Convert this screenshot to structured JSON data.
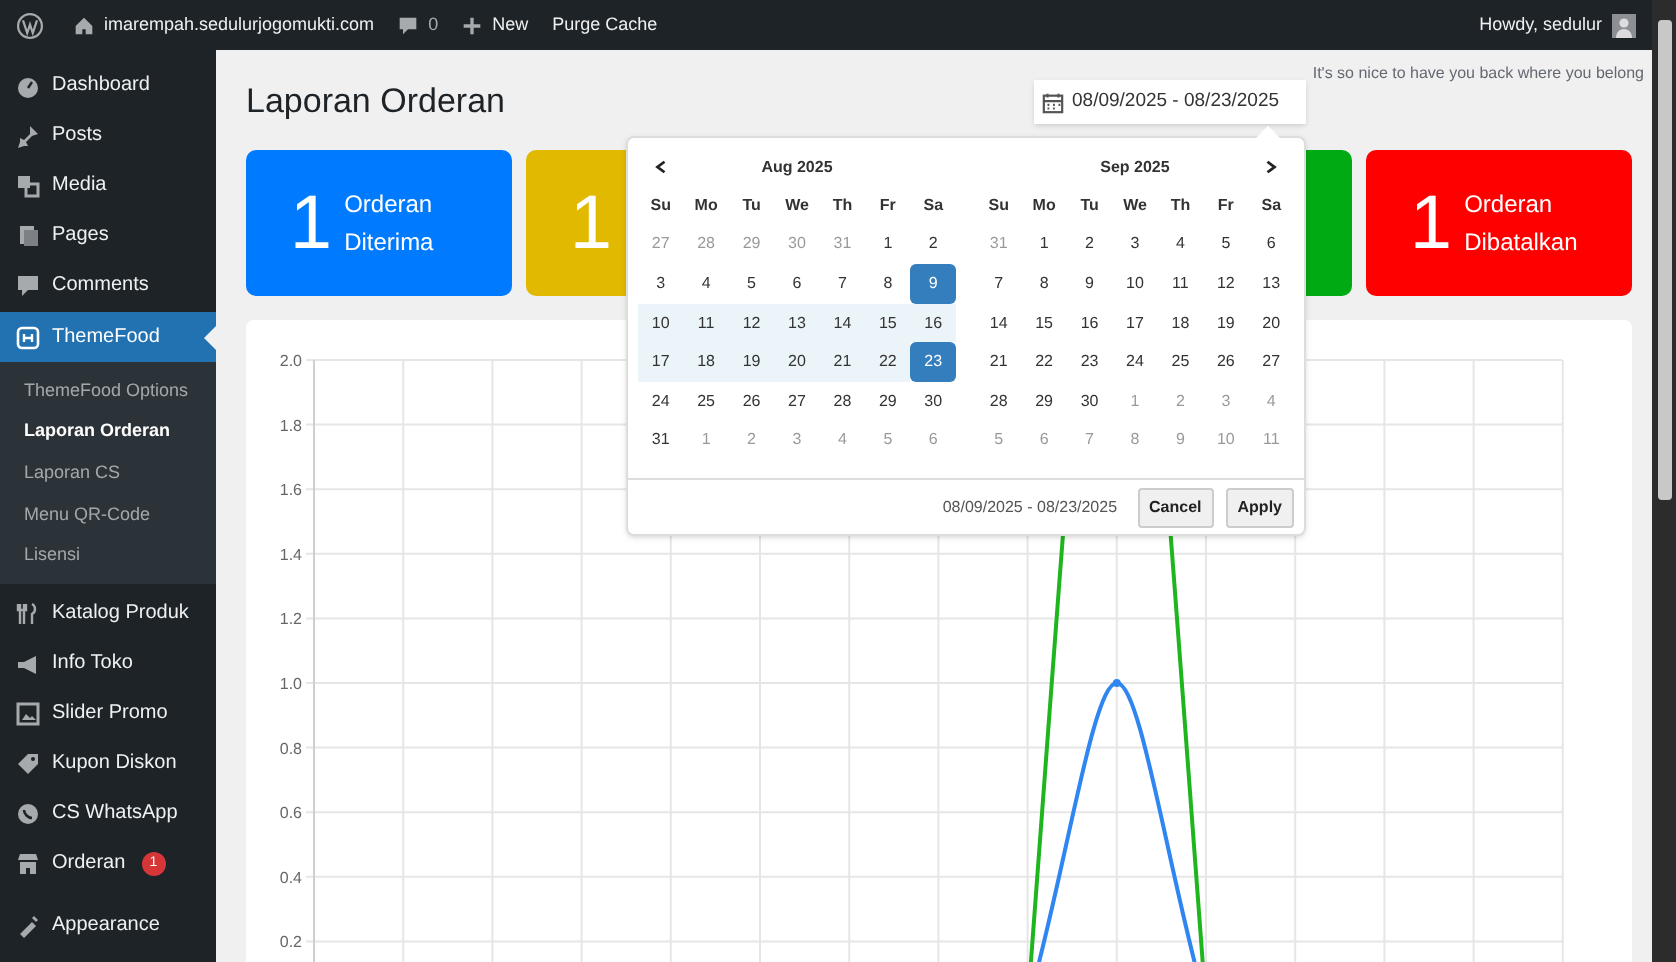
{
  "admin_bar": {
    "site": "imarempah.sedulurjogomukti.com",
    "comments": "0",
    "new": "New",
    "purge_cache": "Purge Cache",
    "greeting": "Howdy, sedulur"
  },
  "sidebar": {
    "items": [
      {
        "label": "Dashboard",
        "selected": false
      },
      {
        "label": "Posts",
        "selected": false
      },
      {
        "label": "Media",
        "selected": false
      },
      {
        "label": "Pages",
        "selected": false
      },
      {
        "label": "Comments",
        "selected": false
      },
      {
        "label": "ThemeFood",
        "selected": true,
        "children": [
          {
            "label": "ThemeFood Options",
            "selected": false
          },
          {
            "label": "Laporan Orderan",
            "selected": true
          },
          {
            "label": "Laporan CS",
            "selected": false
          },
          {
            "label": "Menu QR-Code",
            "selected": false
          },
          {
            "label": "Lisensi",
            "selected": false
          }
        ]
      },
      {
        "label": "Katalog Produk",
        "selected": false
      },
      {
        "label": "Info Toko",
        "selected": false
      },
      {
        "label": "Slider Promo",
        "selected": false
      },
      {
        "label": "Kupon Diskon",
        "selected": false
      },
      {
        "label": "CS WhatsApp",
        "selected": false
      },
      {
        "label": "Orderan",
        "selected": false,
        "badge": "1"
      },
      {
        "label": "Appearance",
        "selected": false
      }
    ]
  },
  "page": {
    "title": "Laporan Orderan",
    "welcome": "It's so nice to have you back where you belong",
    "date_range": "08/09/2025 - 08/23/2025"
  },
  "cards": [
    {
      "color": "#007bff",
      "number": "1",
      "label": "Orderan Diterima"
    },
    {
      "color": "#e0b900",
      "number": "1"
    },
    {
      "color": "#00aa13"
    },
    {
      "color": "#ff0000",
      "number": "1",
      "label": "Orderan Dibatalkan"
    }
  ],
  "chart": {
    "y_labels": [
      "2.0",
      "1.8",
      "1.6",
      "1.4",
      "1.2",
      "1.0",
      "0.8",
      "0.6",
      "0.4",
      "0.2"
    ]
  },
  "date_picker": {
    "months": [
      {
        "title": "Aug 2025",
        "weekdays": [
          "Su",
          "Mo",
          "Tu",
          "We",
          "Th",
          "Fr",
          "Sa"
        ],
        "weeks": [
          [
            {
              "text": "27",
              "off": true,
              "in_range": false,
              "selected": false
            },
            {
              "text": "28",
              "off": true,
              "in_range": false,
              "selected": false
            },
            {
              "text": "29",
              "off": true,
              "in_range": false,
              "selected": false
            },
            {
              "text": "30",
              "off": true,
              "in_range": false,
              "selected": false
            },
            {
              "text": "31",
              "off": true,
              "in_range": false,
              "selected": false
            },
            {
              "text": "1",
              "off": false,
              "in_range": false,
              "selected": false
            },
            {
              "text": "2",
              "off": false,
              "in_range": false,
              "selected": false
            }
          ],
          [
            {
              "text": "3",
              "off": false,
              "in_range": false,
              "selected": false
            },
            {
              "text": "4",
              "off": false,
              "in_range": false,
              "selected": false
            },
            {
              "text": "5",
              "off": false,
              "in_range": false,
              "selected": false
            },
            {
              "text": "6",
              "off": false,
              "in_range": false,
              "selected": false
            },
            {
              "text": "7",
              "off": false,
              "in_range": false,
              "selected": false
            },
            {
              "text": "8",
              "off": false,
              "in_range": false,
              "selected": false
            },
            {
              "text": "9",
              "off": false,
              "in_range": true,
              "selected": true
            }
          ],
          [
            {
              "text": "10",
              "off": false,
              "in_range": true,
              "selected": false
            },
            {
              "text": "11",
              "off": false,
              "in_range": true,
              "selected": false
            },
            {
              "text": "12",
              "off": false,
              "in_range": true,
              "selected": false
            },
            {
              "text": "13",
              "off": false,
              "in_range": true,
              "selected": false
            },
            {
              "text": "14",
              "off": false,
              "in_range": true,
              "selected": false
            },
            {
              "text": "15",
              "off": false,
              "in_range": true,
              "selected": false
            },
            {
              "text": "16",
              "off": false,
              "in_range": true,
              "selected": false
            }
          ],
          [
            {
              "text": "17",
              "off": false,
              "in_range": true,
              "selected": false
            },
            {
              "text": "18",
              "off": false,
              "in_range": true,
              "selected": false
            },
            {
              "text": "19",
              "off": false,
              "in_range": true,
              "selected": false
            },
            {
              "text": "20",
              "off": false,
              "in_range": true,
              "selected": false
            },
            {
              "text": "21",
              "off": false,
              "in_range": true,
              "selected": false
            },
            {
              "text": "22",
              "off": false,
              "in_range": true,
              "selected": false
            },
            {
              "text": "23",
              "off": false,
              "in_range": true,
              "selected": true
            }
          ],
          [
            {
              "text": "24",
              "off": false,
              "in_range": false,
              "selected": false
            },
            {
              "text": "25",
              "off": false,
              "in_range": false,
              "selected": false
            },
            {
              "text": "26",
              "off": false,
              "in_range": false,
              "selected": false
            },
            {
              "text": "27",
              "off": false,
              "in_range": false,
              "selected": false
            },
            {
              "text": "28",
              "off": false,
              "in_range": false,
              "selected": false
            },
            {
              "text": "29",
              "off": false,
              "in_range": false,
              "selected": false
            },
            {
              "text": "30",
              "off": false,
              "in_range": false,
              "selected": false
            }
          ],
          [
            {
              "text": "31",
              "off": false,
              "in_range": false,
              "selected": false
            },
            {
              "text": "1",
              "off": true,
              "in_range": false,
              "selected": false
            },
            {
              "text": "2",
              "off": true,
              "in_range": false,
              "selected": false
            },
            {
              "text": "3",
              "off": true,
              "in_range": false,
              "selected": false
            },
            {
              "text": "4",
              "off": true,
              "in_range": false,
              "selected": false
            },
            {
              "text": "5",
              "off": true,
              "in_range": false,
              "selected": false
            },
            {
              "text": "6",
              "off": true,
              "in_range": false,
              "selected": false
            }
          ]
        ]
      },
      {
        "title": "Sep 2025",
        "weekdays": [
          "Su",
          "Mo",
          "Tu",
          "We",
          "Th",
          "Fr",
          "Sa"
        ],
        "weeks": [
          [
            {
              "text": "31",
              "off": true,
              "in_range": false,
              "selected": false
            },
            {
              "text": "1",
              "off": false,
              "in_range": false,
              "selected": false
            },
            {
              "text": "2",
              "off": false,
              "in_range": false,
              "selected": false
            },
            {
              "text": "3",
              "off": false,
              "in_range": false,
              "selected": false
            },
            {
              "text": "4",
              "off": false,
              "in_range": false,
              "selected": false
            },
            {
              "text": "5",
              "off": false,
              "in_range": false,
              "selected": false
            },
            {
              "text": "6",
              "off": false,
              "in_range": false,
              "selected": false
            }
          ],
          [
            {
              "text": "7",
              "off": false,
              "in_range": false,
              "selected": false
            },
            {
              "text": "8",
              "off": false,
              "in_range": false,
              "selected": false
            },
            {
              "text": "9",
              "off": false,
              "in_range": false,
              "selected": false
            },
            {
              "text": "10",
              "off": false,
              "in_range": false,
              "selected": false
            },
            {
              "text": "11",
              "off": false,
              "in_range": false,
              "selected": false
            },
            {
              "text": "12",
              "off": false,
              "in_range": false,
              "selected": false
            },
            {
              "text": "13",
              "off": false,
              "in_range": false,
              "selected": false
            }
          ],
          [
            {
              "text": "14",
              "off": false,
              "in_range": false,
              "selected": false
            },
            {
              "text": "15",
              "off": false,
              "in_range": false,
              "selected": false
            },
            {
              "text": "16",
              "off": false,
              "in_range": false,
              "selected": false
            },
            {
              "text": "17",
              "off": false,
              "in_range": false,
              "selected": false
            },
            {
              "text": "18",
              "off": false,
              "in_range": false,
              "selected": false
            },
            {
              "text": "19",
              "off": false,
              "in_range": false,
              "selected": false
            },
            {
              "text": "20",
              "off": false,
              "in_range": false,
              "selected": false
            }
          ],
          [
            {
              "text": "21",
              "off": false,
              "in_range": false,
              "selected": false
            },
            {
              "text": "22",
              "off": false,
              "in_range": false,
              "selected": false
            },
            {
              "text": "23",
              "off": false,
              "in_range": false,
              "selected": false
            },
            {
              "text": "24",
              "off": false,
              "in_range": false,
              "selected": false
            },
            {
              "text": "25",
              "off": false,
              "in_range": false,
              "selected": false
            },
            {
              "text": "26",
              "off": false,
              "in_range": false,
              "selected": false
            },
            {
              "text": "27",
              "off": false,
              "in_range": false,
              "selected": false
            }
          ],
          [
            {
              "text": "28",
              "off": false,
              "in_range": false,
              "selected": false
            },
            {
              "text": "29",
              "off": false,
              "in_range": false,
              "selected": false
            },
            {
              "text": "30",
              "off": false,
              "in_range": false,
              "selected": false
            },
            {
              "text": "1",
              "off": true,
              "in_range": false,
              "selected": false
            },
            {
              "text": "2",
              "off": true,
              "in_range": false,
              "selected": false
            },
            {
              "text": "3",
              "off": true,
              "in_range": false,
              "selected": false
            },
            {
              "text": "4",
              "off": true,
              "in_range": false,
              "selected": false
            }
          ],
          [
            {
              "text": "5",
              "off": true,
              "in_range": false,
              "selected": false
            },
            {
              "text": "6",
              "off": true,
              "in_range": false,
              "selected": false
            },
            {
              "text": "7",
              "off": true,
              "in_range": false,
              "selected": false
            },
            {
              "text": "8",
              "off": true,
              "in_range": false,
              "selected": false
            },
            {
              "text": "9",
              "off": true,
              "in_range": false,
              "selected": false
            },
            {
              "text": "10",
              "off": true,
              "in_range": false,
              "selected": false
            },
            {
              "text": "11",
              "off": true,
              "in_range": false,
              "selected": false
            }
          ]
        ]
      }
    ],
    "selected_range": "08/09/2025 - 08/23/2025",
    "buttons": [
      "Cancel",
      "Apply"
    ]
  }
}
